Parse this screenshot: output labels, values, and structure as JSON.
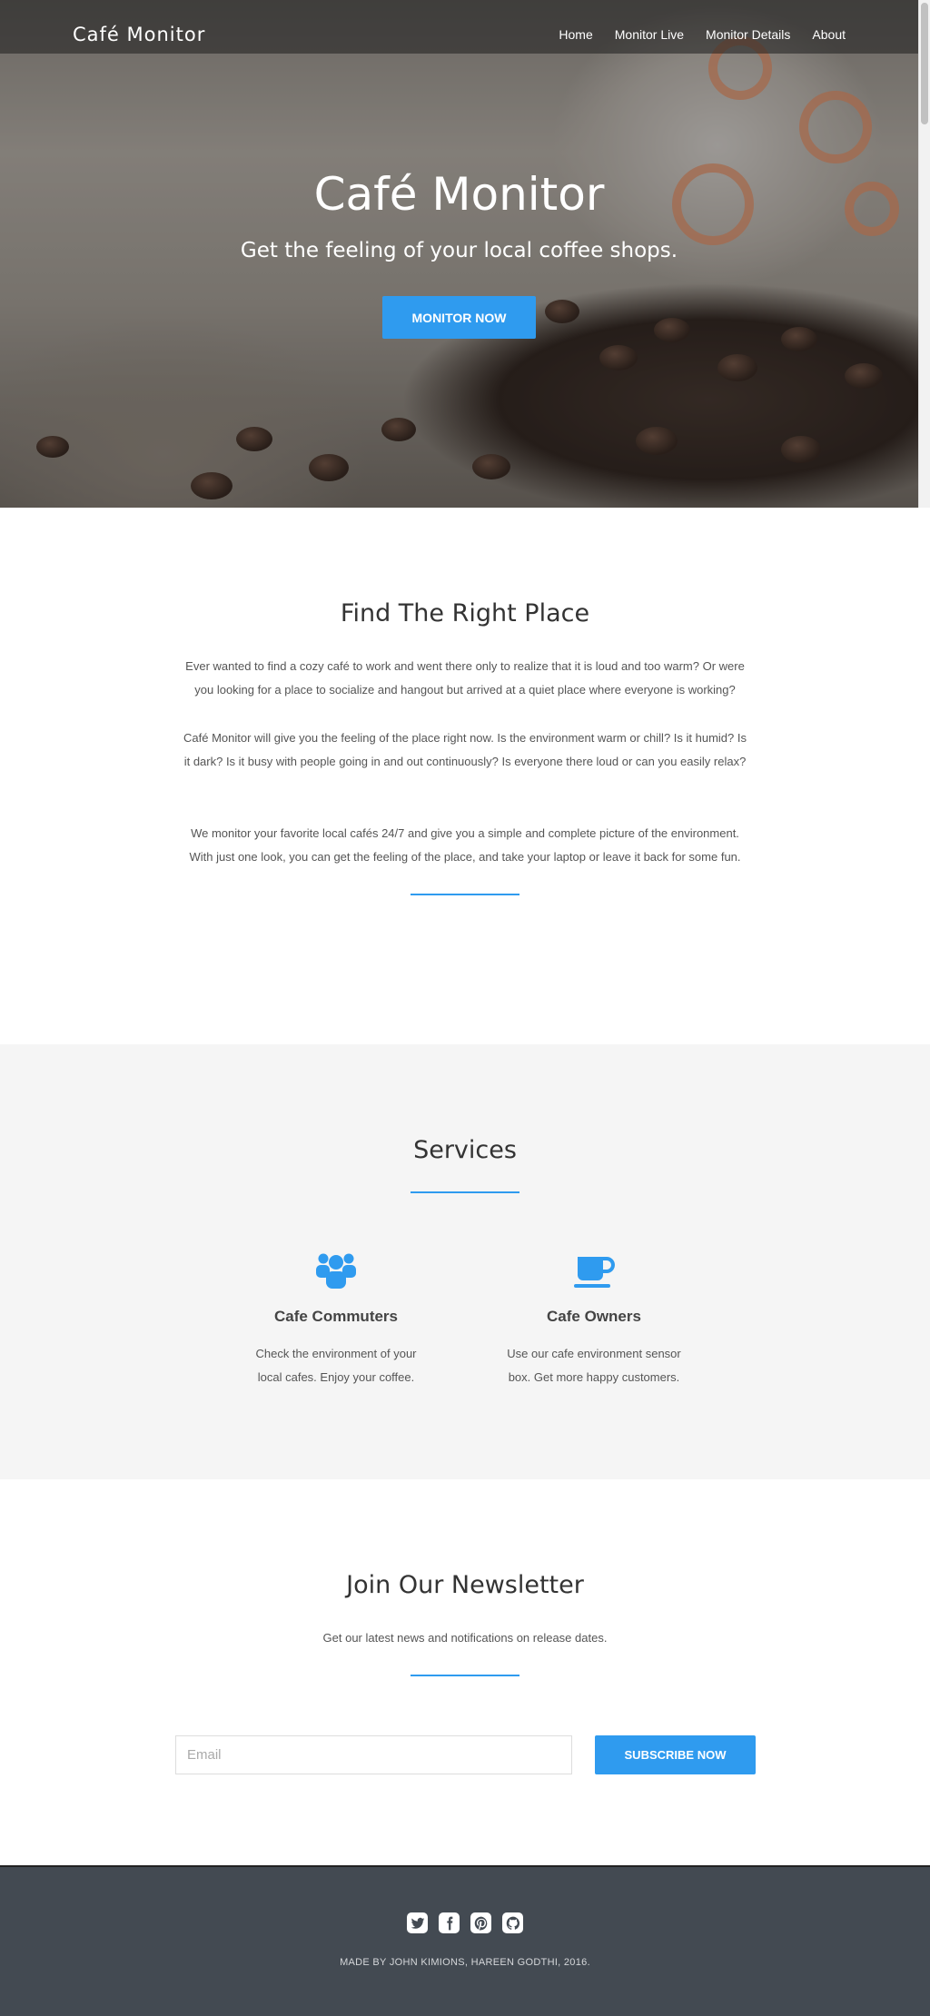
{
  "nav": {
    "brand": "Café Monitor",
    "links": [
      "Home",
      "Monitor Live",
      "Monitor Details",
      "About"
    ]
  },
  "hero": {
    "title": "Café Monitor",
    "subtitle": "Get the feeling of your local coffee shops.",
    "cta_label": "MONITOR NOW"
  },
  "about": {
    "title": "Find The Right Place",
    "paragraphs": [
      "Ever wanted to find a cozy café to work and went there only to realize that it is loud and too warm? Or were you looking for a place to socialize and hangout but arrived at a quiet place where everyone is working?",
      "Café Monitor will give you the feeling of the place right now. Is the environment warm or chill? Is it humid? Is it dark? Is it busy with people going in and out continuously? Is everyone there loud or can you easily relax?",
      "We monitor your favorite local cafés 24/7 and give you a simple and complete picture of the environment. With just one look, you can get the feeling of the place, and take your laptop or leave it back for some fun."
    ]
  },
  "services": {
    "title": "Services",
    "items": [
      {
        "icon": "users-icon",
        "title": "Cafe Commuters",
        "text": "Check the environment of your local cafes. Enjoy your coffee."
      },
      {
        "icon": "coffee-cup-icon",
        "title": "Cafe Owners",
        "text": "Use our cafe environment sensor box. Get more happy customers."
      }
    ]
  },
  "newsletter": {
    "title": "Join Our Newsletter",
    "subtitle": "Get our latest news and notifications on release dates.",
    "email_placeholder": "Email",
    "email_value": "",
    "subscribe_label": "SUBSCRIBE NOW"
  },
  "footer": {
    "social_icons": [
      "twitter-icon",
      "facebook-icon",
      "pinterest-icon",
      "github-icon"
    ],
    "credit": "MADE BY JOHN KIMIONS, HAREEN GODTHI, 2016."
  },
  "colors": {
    "accent": "#2f9bef",
    "footer_bg": "#434a52",
    "services_bg": "#f5f5f5"
  }
}
